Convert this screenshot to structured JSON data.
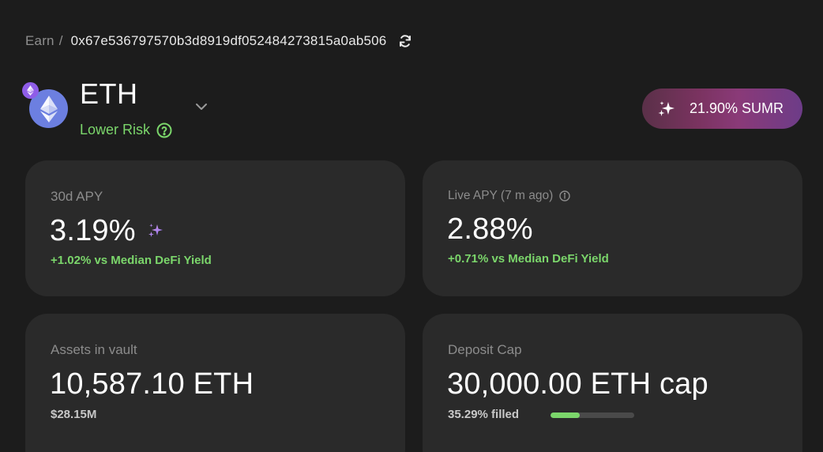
{
  "breadcrumb": {
    "root": "Earn",
    "separator": "/",
    "address": "0x67e536797570b3d8919df052484273815a0ab506"
  },
  "icons": {
    "refresh": "refresh-icon",
    "token": "ethereum-icon",
    "network": "ethereum-network-icon",
    "chevron": "chevron-down-icon",
    "help": "help-circle-icon",
    "sparkle": "sparkle-icon",
    "info": "info-icon"
  },
  "header": {
    "token": "ETH",
    "risk_label": "Lower Risk",
    "reward_pill": "21.90% SUMR"
  },
  "cards": {
    "apy_30d": {
      "label": "30d APY",
      "value": "3.19%",
      "sub": "+1.02% vs Median DeFi Yield"
    },
    "live_apy": {
      "label": "Live APY (7 m ago)",
      "value": "2.88%",
      "sub": "+0.71% vs Median DeFi Yield"
    },
    "assets": {
      "label": "Assets in vault",
      "value": "10,587.10 ETH",
      "sub": "$28.15M"
    },
    "deposit_cap": {
      "label": "Deposit Cap",
      "value": "30,000.00 ETH cap",
      "sub": "35.29% filled",
      "filled_fraction": 0.3529
    }
  },
  "colors": {
    "background": "#1c1c1c",
    "card": "#2a2a2a",
    "positive": "#7bd66b",
    "eth_blue": "#6c7fe0",
    "network_purple": "#8f5de8"
  }
}
